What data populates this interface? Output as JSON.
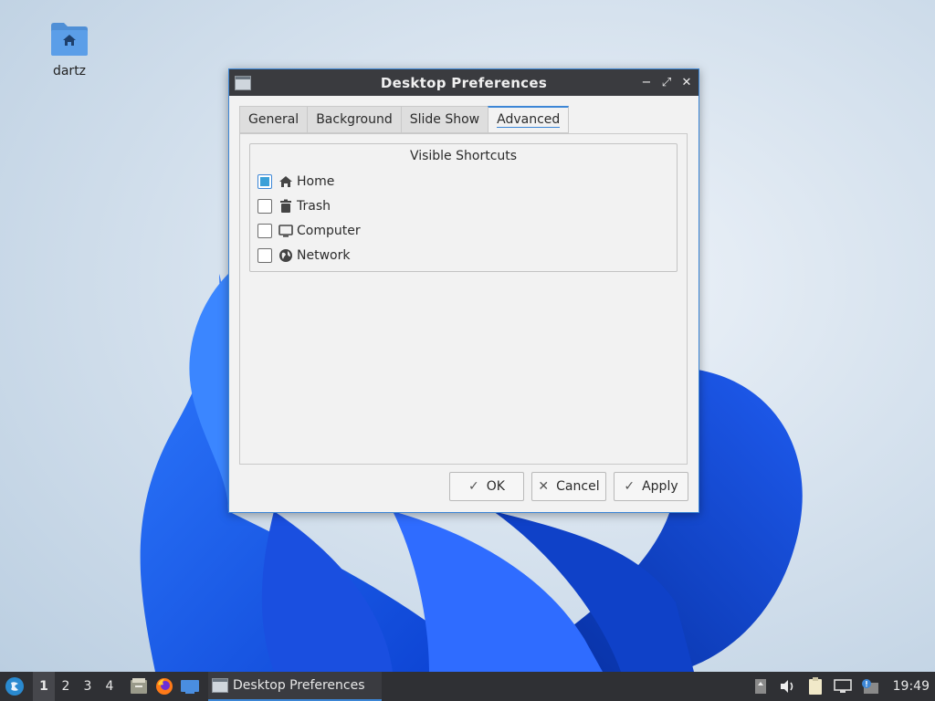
{
  "desktop": {
    "icons": [
      {
        "label": "dartz",
        "icon": "home-folder-icon"
      }
    ]
  },
  "window": {
    "title": "Desktop Preferences",
    "controls": {
      "minimize": "−",
      "maximize": "⤢",
      "close": "✕"
    },
    "tabs": [
      {
        "label": "General",
        "active": false
      },
      {
        "label": "Background",
        "active": false
      },
      {
        "label": "Slide Show",
        "active": false
      },
      {
        "label": "Advanced",
        "active": true
      }
    ],
    "group_title": "Visible Shortcuts",
    "shortcuts": [
      {
        "label": "Home",
        "checked": true,
        "icon": "home-icon"
      },
      {
        "label": "Trash",
        "checked": false,
        "icon": "trash-icon"
      },
      {
        "label": "Computer",
        "checked": false,
        "icon": "computer-icon"
      },
      {
        "label": "Network",
        "checked": false,
        "icon": "network-icon"
      }
    ],
    "buttons": {
      "ok": {
        "label": "OK",
        "glyph": "✓"
      },
      "cancel": {
        "label": "Cancel",
        "glyph": "✕"
      },
      "apply": {
        "label": "Apply",
        "glyph": "✓"
      }
    }
  },
  "taskbar": {
    "workspaces": [
      "1",
      "2",
      "3",
      "4"
    ],
    "active_workspace": "1",
    "task_title": "Desktop Preferences",
    "clock": "19:49"
  },
  "colors": {
    "accent": "#3c86d6",
    "taskbar": "#2f3034",
    "titlebar": "#3a3b3f"
  }
}
